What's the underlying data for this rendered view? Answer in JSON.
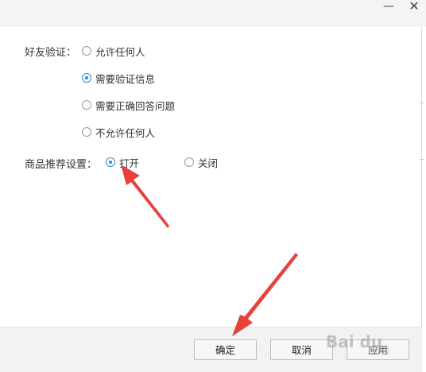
{
  "window": {
    "minimize_glyph": "—",
    "close_glyph": "✕"
  },
  "friend_verification": {
    "label": "好友验证：",
    "options": [
      {
        "label": "允许任何人",
        "checked": false
      },
      {
        "label": "需要验证信息",
        "checked": true
      },
      {
        "label": "需要正确回答问题",
        "checked": false
      },
      {
        "label": "不允许任何人",
        "checked": false
      }
    ]
  },
  "product_recommendation": {
    "label": "商品推荐设置：",
    "options": [
      {
        "label": "打开",
        "checked": true
      },
      {
        "label": "关闭",
        "checked": false
      }
    ]
  },
  "footer": {
    "ok_label": "确定",
    "cancel_label": "取消",
    "apply_label": "应用"
  },
  "watermark": {
    "text": "Bai du",
    "sub": "经验"
  },
  "colors": {
    "accent": "#2b8ad8",
    "annotation_arrow": "#e8413c"
  }
}
